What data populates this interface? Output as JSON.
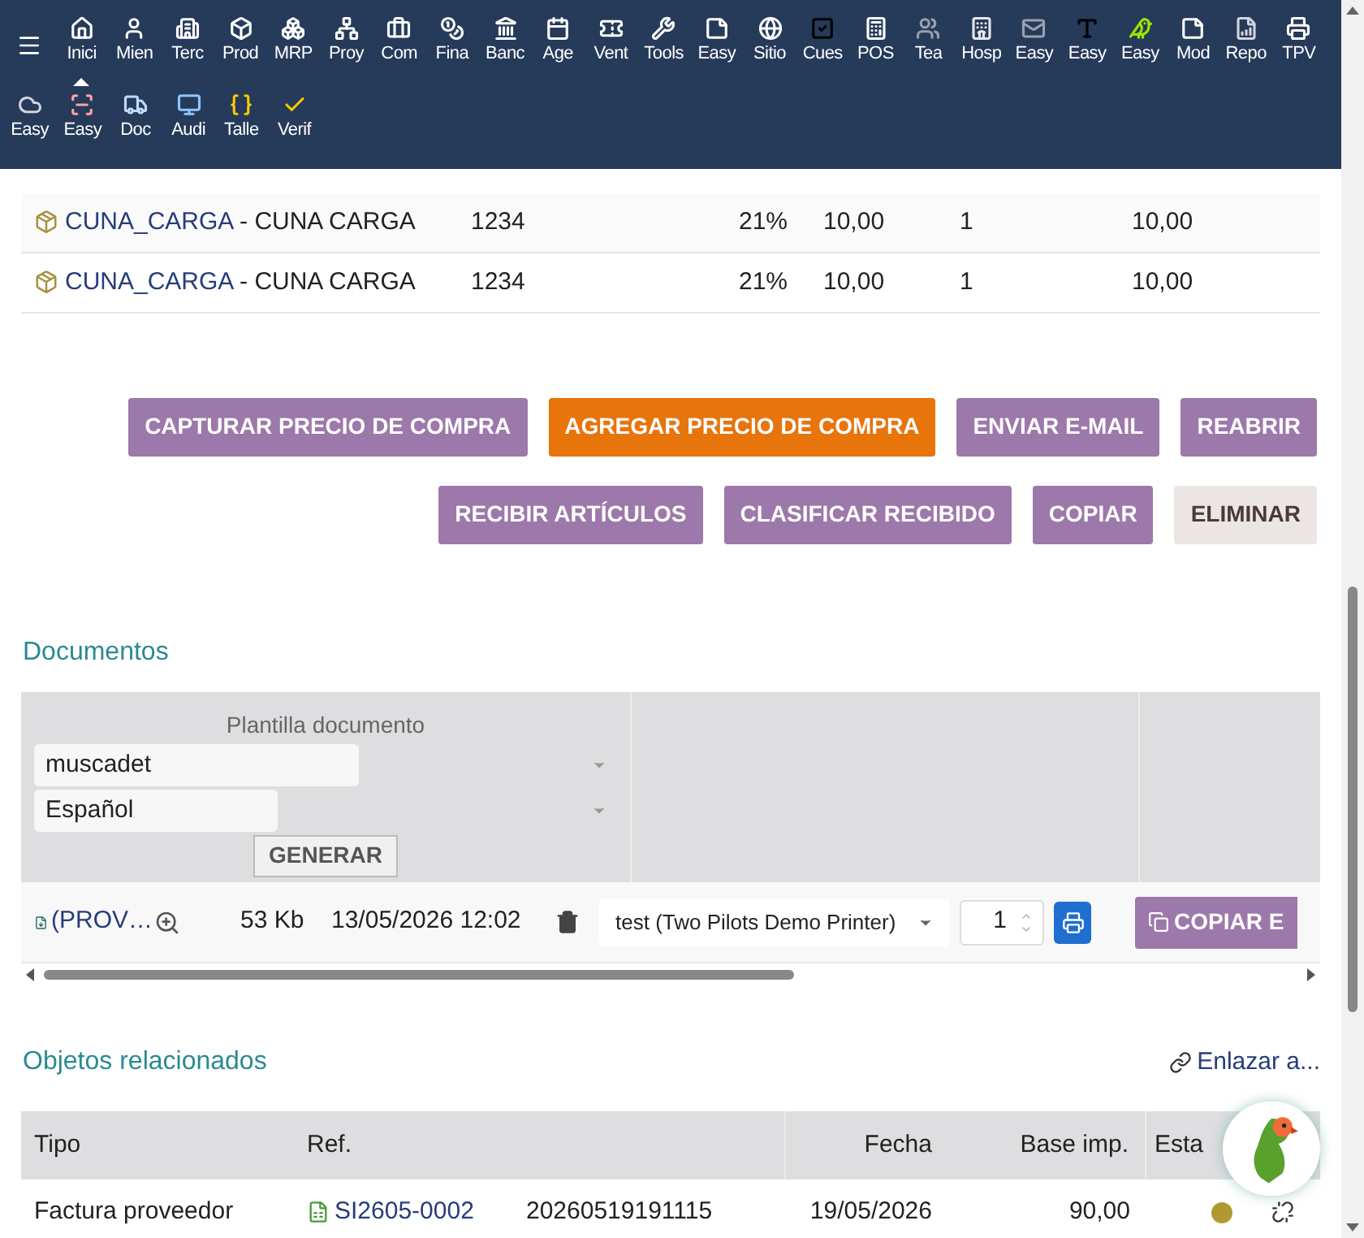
{
  "menu": {
    "items": [
      {
        "label": "Inici",
        "selected": true
      },
      {
        "label": "Mien",
        "selected": false
      },
      {
        "label": "Terc",
        "selected": false
      },
      {
        "label": "Prod",
        "selected": false
      },
      {
        "label": "MRP",
        "selected": false
      },
      {
        "label": "Proy",
        "selected": false
      },
      {
        "label": "Com",
        "selected": false
      },
      {
        "label": "Fina",
        "selected": false
      },
      {
        "label": "Banc",
        "selected": false
      },
      {
        "label": "Age",
        "selected": false
      },
      {
        "label": "Vent",
        "selected": false
      },
      {
        "label": "Tools",
        "selected": false
      },
      {
        "label": "Easy",
        "selected": false
      },
      {
        "label": "Sitio",
        "selected": false
      },
      {
        "label": "Cues",
        "selected": false
      },
      {
        "label": "POS",
        "selected": false
      },
      {
        "label": "Tea",
        "selected": false
      },
      {
        "label": "Hosp",
        "selected": false
      },
      {
        "label": "Easy",
        "selected": false
      },
      {
        "label": "Easy",
        "selected": false
      },
      {
        "label": "Easy",
        "selected": false
      },
      {
        "label": "Mod",
        "selected": false
      },
      {
        "label": "Repo",
        "selected": false
      },
      {
        "label": "TPV",
        "selected": false
      },
      {
        "label": "Easy",
        "selected": false
      },
      {
        "label": "Easy",
        "selected": false
      },
      {
        "label": "Doc",
        "selected": false
      },
      {
        "label": "Audi",
        "selected": false
      },
      {
        "label": "Talle",
        "selected": false
      },
      {
        "label": "Verif",
        "selected": false
      }
    ]
  },
  "lines": [
    {
      "code": "CUNA_CARGA",
      "label": " - CUNA CARGA",
      "ref": "1234",
      "tax": "21%",
      "price": "10,00",
      "qty": "1",
      "total": "10,00"
    },
    {
      "code": "CUNA_CARGA",
      "label": " - CUNA CARGA",
      "ref": "1234",
      "tax": "21%",
      "price": "10,00",
      "qty": "1",
      "total": "10,00"
    }
  ],
  "actions": [
    [
      {
        "label": "CAPTURAR PRECIO DE COMPRA",
        "kind": "normal"
      },
      {
        "label": "AGREGAR PRECIO DE COMPRA",
        "kind": "highlight"
      },
      {
        "label": "ENVIAR E-MAIL",
        "kind": "normal"
      },
      {
        "label": "REABRIR",
        "kind": "normal"
      }
    ],
    [
      {
        "label": "RECIBIR ARTÍCULOS",
        "kind": "normal"
      },
      {
        "label": "CLASIFICAR RECIBIDO",
        "kind": "normal"
      },
      {
        "label": "COPIAR",
        "kind": "normal"
      },
      {
        "label": "ELIMINAR",
        "kind": "danger"
      }
    ]
  ],
  "documents": {
    "title": "Documentos",
    "template_label": "Plantilla documento",
    "template": "muscadet",
    "language": "Español",
    "generate": "GENERAR",
    "file": {
      "name": "(PROV…",
      "size": "53 Kb",
      "date": "13/05/2026 12:02",
      "printer": "test (Two Pilots Demo Printer)",
      "copies": "1",
      "copy_button": "COPIAR E"
    }
  },
  "related": {
    "title": "Objetos relacionados",
    "link": "Enlazar a...",
    "columns": [
      "Tipo",
      "Ref.",
      "",
      "Fecha",
      "Base imp.",
      "Esta"
    ],
    "rows": [
      {
        "type": "Factura proveedor",
        "ref": "SI2605-0002",
        "ref_supplier": "20260519191115",
        "date": "19/05/2026",
        "amount": "90,00",
        "color": "#b09a30"
      }
    ]
  }
}
